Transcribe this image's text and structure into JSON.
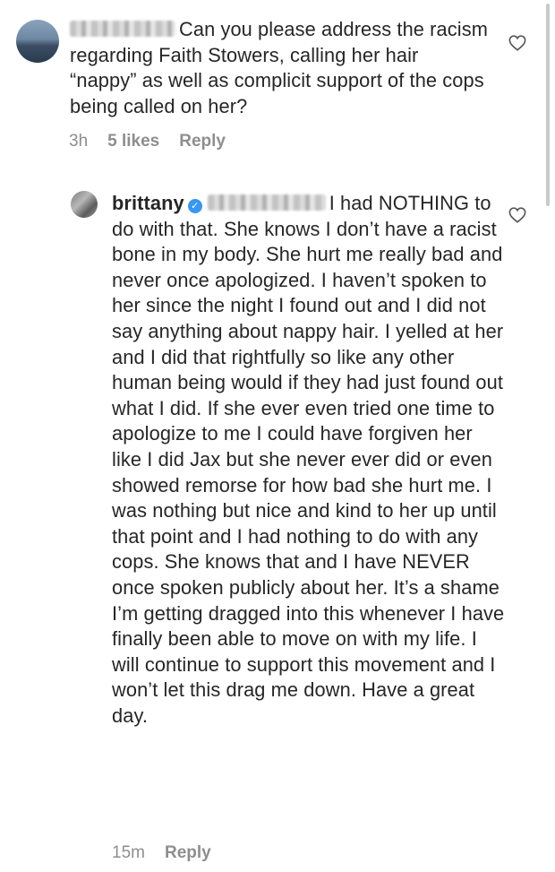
{
  "comments": [
    {
      "username_hidden": true,
      "text": "Can you please address the racism regarding Faith Stowers, calling her hair “nappy” as well as complicit support of the cops being called on her?",
      "time": "3h",
      "likes": "5 likes",
      "reply_label": "Reply"
    },
    {
      "username": "brittany",
      "verified": true,
      "mention_hidden": true,
      "text": "I had NOTHING to do with that. She knows I don’t have a racist bone in my body. She hurt me really bad and never once apologized. I haven’t spoken to her since the night I found out and I did not say anything about nappy hair. I yelled at her and I did that rightfully so like any other human being would if they had just found out what I did. If she ever even tried one time to apologize to me I could have forgiven her like I did Jax but she never ever did or even showed remorse for how bad she hurt me. I was nothing but nice and kind to her up until that point and I had nothing to do with any cops. She knows that and I have NEVER once spoken publicly about her. It’s a shame I’m getting dragged into this whenever I have finally been able to move on with my life. I will continue to support this movement and I won’t let this drag me down. Have a great day.",
      "time": "15m",
      "reply_label": "Reply"
    }
  ],
  "icons": {
    "like": "heart-outline-icon",
    "verified": "verified-badge-icon"
  },
  "colors": {
    "text": "#262626",
    "meta": "#8e8e8e",
    "verified": "#3897f0"
  }
}
